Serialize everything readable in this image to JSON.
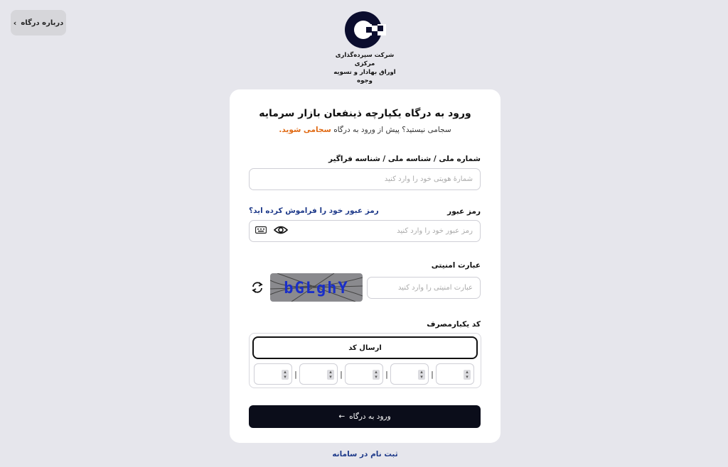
{
  "about": {
    "label": "درباره درگاه",
    "chevron": "›"
  },
  "logo": {
    "line1": "شرکت سپرده‌گذاری مرکزی",
    "line2": "اوراق بهادار و تسویه وجوه"
  },
  "form": {
    "title": "ورود به درگاه یکپارچه ذینفعان بازار سرمایه",
    "subtitle_prefix": "سجامی نیستید؟ پیش از ورود به درگاه",
    "subtitle_link": "سجامی شوید.",
    "national_id": {
      "label": "شماره ملی / شناسه ملی / شناسه فراگیر",
      "placeholder": "شمارهٔ هویتی خود را وارد کنید"
    },
    "password": {
      "label": "رمز عبور",
      "placeholder": "رمز عبور خود را وارد کنید",
      "forgot": "رمز عبور خود را فراموش کرده اید؟"
    },
    "captcha": {
      "label": "عبارت امنیتی",
      "placeholder": "عبارت امنیتی را وارد کنید",
      "image_text": "bGLghY"
    },
    "otp": {
      "label": "کد یکبارمصرف",
      "send_label": "ارسال کد",
      "separator": "|",
      "digits": [
        "",
        "",
        "",
        "",
        ""
      ]
    },
    "submit_label": "ورود به درگاه",
    "submit_arrow": "←"
  },
  "register_link": "ثبت نام در سامانه"
}
